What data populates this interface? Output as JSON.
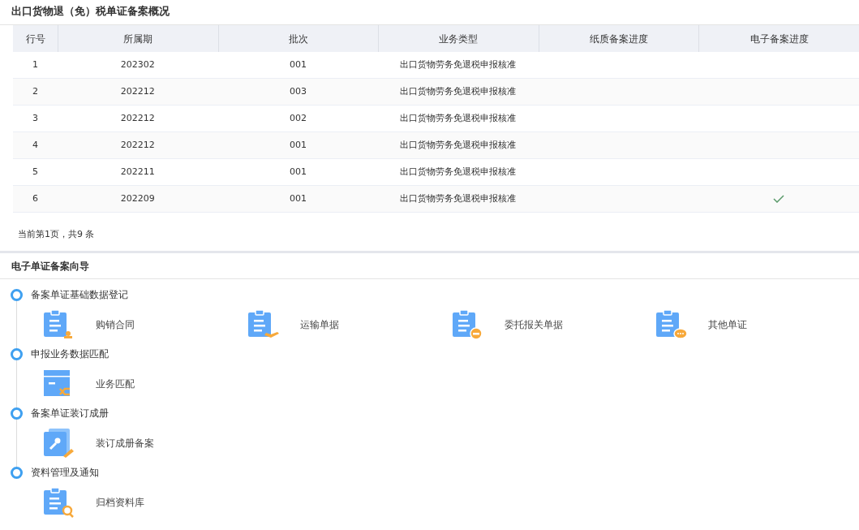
{
  "overview": {
    "title": "出口货物退（免）税单证备案概况",
    "table": {
      "columns": [
        "行号",
        "所属期",
        "批次",
        "业务类型",
        "纸质备案进度",
        "电子备案进度"
      ],
      "rows": [
        {
          "no": "1",
          "period": "202302",
          "batch": "001",
          "type": "出口货物劳务免退税申报核准",
          "electronic_done": false
        },
        {
          "no": "2",
          "period": "202212",
          "batch": "003",
          "type": "出口货物劳务免退税申报核准",
          "electronic_done": false
        },
        {
          "no": "3",
          "period": "202212",
          "batch": "002",
          "type": "出口货物劳务免退税申报核准",
          "electronic_done": false
        },
        {
          "no": "4",
          "period": "202212",
          "batch": "001",
          "type": "出口货物劳务免退税申报核准",
          "electronic_done": false
        },
        {
          "no": "5",
          "period": "202211",
          "batch": "001",
          "type": "出口货物劳务免退税申报核准",
          "electronic_done": false
        },
        {
          "no": "6",
          "period": "202209",
          "batch": "001",
          "type": "出口货物劳务免退税申报核准",
          "electronic_done": true
        }
      ]
    },
    "pagination": "当前第1页，共9 条"
  },
  "guide": {
    "title": "电子单证备案向导",
    "steps": [
      {
        "title": "备案单证基础数据登记",
        "items": [
          "购销合同",
          "运输单据",
          "委托报关单据",
          "其他单证"
        ]
      },
      {
        "title": "申报业务数据匹配",
        "items": [
          "业务匹配"
        ]
      },
      {
        "title": "备案单证装订成册",
        "items": [
          "装订成册备案"
        ]
      },
      {
        "title": "资料管理及通知",
        "items": [
          "归档资料库"
        ]
      }
    ]
  }
}
